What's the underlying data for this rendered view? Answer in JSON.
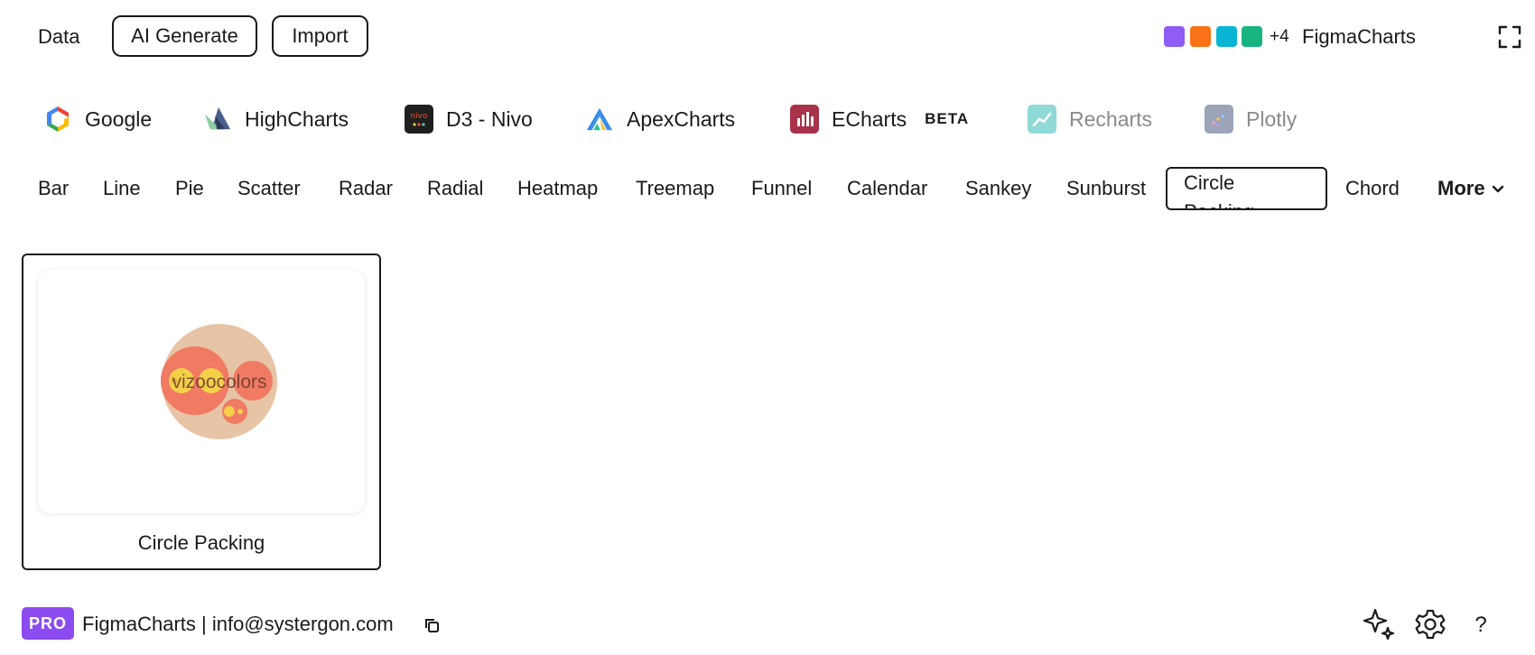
{
  "toolbar": {
    "data_label": "Data",
    "ai_generate_label": "AI Generate",
    "import_label": "Import",
    "palette_colors": [
      "#8f5cf6",
      "#f97216",
      "#0ab4d4",
      "#17b482"
    ],
    "palette_more": "+4",
    "brand": "FigmaCharts",
    "fullscreen_icon": "fullscreen-icon"
  },
  "libraries": [
    {
      "label": "Google",
      "icon": "google-logo",
      "enabled": true
    },
    {
      "label": "HighCharts",
      "icon": "highcharts-logo",
      "enabled": true
    },
    {
      "label": "D3 - Nivo",
      "icon": "nivo-logo",
      "enabled": true
    },
    {
      "label": "ApexCharts",
      "icon": "apexcharts-logo",
      "enabled": true
    },
    {
      "label": "ECharts",
      "icon": "echarts-logo",
      "enabled": true,
      "badge": "BETA"
    },
    {
      "label": "Recharts",
      "icon": "recharts-logo",
      "enabled": false
    },
    {
      "label": "Plotly",
      "icon": "plotly-logo",
      "enabled": false
    }
  ],
  "categories": [
    "Bar",
    "Line",
    "Pie",
    "Scatter",
    "Radar",
    "Radial",
    "Heatmap",
    "Treemap",
    "Funnel",
    "Calendar",
    "Sankey",
    "Sunburst",
    "Circle Packing",
    "Chord"
  ],
  "selected_category": "Circle Packing",
  "more_label": "More",
  "templates": [
    {
      "label": "Circle Packing",
      "preview_text": "vizoocolors"
    }
  ],
  "footer": {
    "pro_badge": "PRO",
    "text": "FigmaCharts | info@systergon.com",
    "icons": [
      "copy-icon",
      "sparkle-icon",
      "gear-icon",
      "help-icon"
    ],
    "help_glyph": "?"
  }
}
